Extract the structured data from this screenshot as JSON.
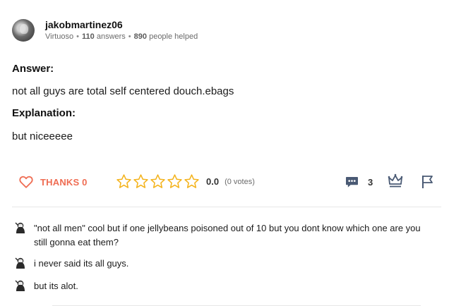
{
  "author": {
    "username": "jakobmartinez06",
    "rank": "Virtuoso",
    "answers_count": "110",
    "answers_label": "answers",
    "helped_count": "890",
    "helped_label": "people helped"
  },
  "answer": {
    "answer_title": "Answer:",
    "answer_text": "not all guys are total self centered douch.ebags",
    "explanation_title": "Explanation:",
    "explanation_text": "but niceeeee"
  },
  "actions": {
    "thanks_label": "THANKS 0",
    "rating_value": "0.0",
    "stars_filled": 0,
    "stars_total": 5,
    "votes_label": "(0 votes)",
    "comments_count": "3"
  },
  "comments": [
    {
      "text": "\"not all men\" cool but if one jellybeans poisoned out of 10 but you dont know which one are you still gonna eat them?"
    },
    {
      "text": "i never said its all guys."
    },
    {
      "text": "but its alot."
    }
  ],
  "colors": {
    "accent": "#ef6c52",
    "star_outline": "#f4b31c",
    "icon_blue": "#4a5a74"
  }
}
